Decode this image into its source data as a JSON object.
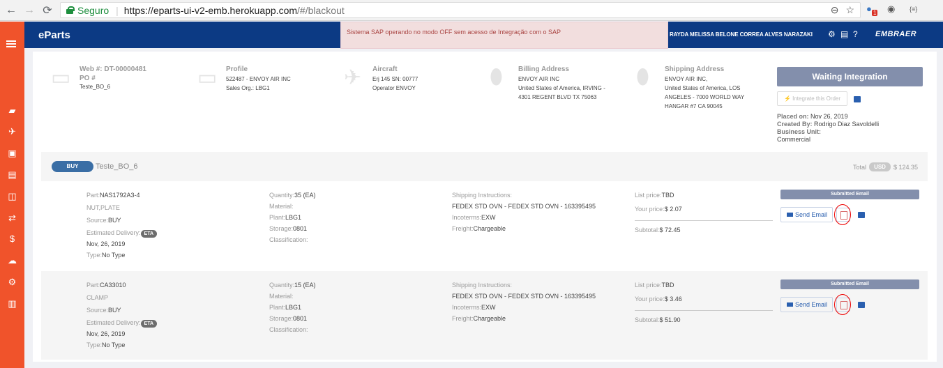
{
  "browser": {
    "secure_label": "Seguro",
    "url_host": "https://eparts-ui-v2-emb.herokuapp.com",
    "url_path": "/#/blackout",
    "ext_badge": "1",
    "ext_label": "{≡}"
  },
  "header": {
    "brand": "eParts",
    "alert": "Sistema SAP operando no modo OFF sem acesso de Integração com o SAP",
    "user": "RAYDA MELISSA BELONE CORREA ALVES NARAZAKI",
    "logo": "EMBRAER"
  },
  "info": {
    "web": {
      "title": "Web #: DT-00000481",
      "po": "PO #",
      "ref": "Teste_BO_6"
    },
    "profile": {
      "title": "Profile",
      "line1": "522487 - ENVOY AIR INC",
      "line2": "Sales Org.: LBG1"
    },
    "aircraft": {
      "title": "Aircraft",
      "line1": "Erj 145 SN: 00777",
      "line2": "Operator ENVOY"
    },
    "billing": {
      "title": "Billing Address",
      "line1": "ENVOY AIR INC",
      "line2": "United States of America, IRVING -",
      "line3": "4301 REGENT BLVD TX 75063"
    },
    "shipping": {
      "title": "Shipping Address",
      "line1": "ENVOY AIR INC,",
      "line2": "United States of America, LOS",
      "line3": "ANGELES - 7000 WORLD WAY",
      "line4": "HANGAR #7 CA 90045"
    }
  },
  "status": {
    "button": "Waiting Integration",
    "integrate": "⚡ Integrate this Order",
    "placed_label": "Placed on:",
    "placed_value": "Nov 26, 2019",
    "created_label": "Created By:",
    "created_value": "Rodrigo Diaz Savoldelli",
    "bu_label": "Business Unit:",
    "bu_value": "Commercial"
  },
  "order": {
    "badge": "BUY",
    "ref": "Teste_BO_6",
    "total_label": "Total",
    "currency": "USD",
    "total": "$ 124.35"
  },
  "items": [
    {
      "part_label": "Part:",
      "part": "NAS1792A3-4",
      "desc": "NUT,PLATE",
      "source_label": "Source:",
      "source": "BUY",
      "eta_label": "Estimated Delivery:",
      "eta": "ETA",
      "eta_date": "Nov, 26, 2019",
      "type_label": "Type:",
      "type": "No Type",
      "qty_label": "Quantity:",
      "qty": "35 (EA)",
      "material_label": "Material:",
      "plant_label": "Plant:",
      "plant": "LBG1",
      "storage_label": "Storage:",
      "storage": "0801",
      "class_label": "Classification:",
      "ship_label": "Shipping Instructions:",
      "ship": "FEDEX STD OVN - FEDEX STD OVN - 163395495",
      "inco_label": "Incoterms:",
      "inco": "EXW",
      "freight_label": "Freight:",
      "freight": "Chargeable",
      "list_label": "List price:",
      "list": "TBD",
      "your_label": "Your price:",
      "your": "$ 2.07",
      "subtotal_label": "Subtotal:",
      "subtotal": "$ 72.45",
      "email_status": "Submitted Email",
      "send": "Send Email"
    },
    {
      "part_label": "Part:",
      "part": "CA33010",
      "desc": "CLAMP",
      "source_label": "Source:",
      "source": "BUY",
      "eta_label": "Estimated Delivery:",
      "eta": "ETA",
      "eta_date": "Nov, 26, 2019",
      "type_label": "Type:",
      "type": "No Type",
      "qty_label": "Quantity:",
      "qty": "15 (EA)",
      "material_label": "Material:",
      "plant_label": "Plant:",
      "plant": "LBG1",
      "storage_label": "Storage:",
      "storage": "0801",
      "class_label": "Classification:",
      "ship_label": "Shipping Instructions:",
      "ship": "FEDEX STD OVN - FEDEX STD OVN - 163395495",
      "inco_label": "Incoterms:",
      "inco": "EXW",
      "freight_label": "Freight:",
      "freight": "Chargeable",
      "list_label": "List price:",
      "list": "TBD",
      "your_label": "Your price:",
      "your": "$ 3.46",
      "subtotal_label": "Subtotal:",
      "subtotal": "$ 51.90",
      "email_status": "Submitted Email",
      "send": "Send Email"
    }
  ],
  "sidebar_icons": [
    "menu-icon",
    "truck-icon",
    "plane-icon",
    "cart-icon",
    "document-icon",
    "box-icon",
    "exchange-icon",
    "dollar-icon",
    "cloud-icon",
    "settings-icon",
    "chart-icon"
  ]
}
